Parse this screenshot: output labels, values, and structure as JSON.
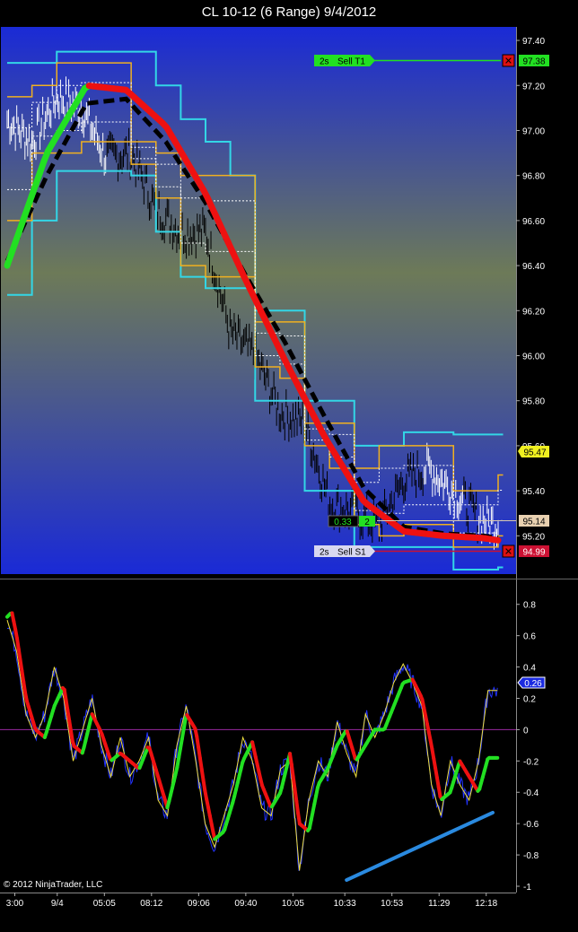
{
  "window": {
    "title": "CL 10-12 (6 Range)  9/4/2012"
  },
  "copyright": "© 2012 NinjaTrader, LLC",
  "colors": {
    "background": "#000000",
    "price_top": "#1a2ad6",
    "price_mid": "#6d7a58",
    "price_bottom": "#1a2ad6",
    "bar_color_up": "#ffffff",
    "bar_color_down": "#000000",
    "bands": "#33d6e6",
    "channel": "#f0b020",
    "inner_band": "#ffffff",
    "osc_fast": "#2233ff",
    "osc_signal": "#f0e040",
    "hma_up": "#22e022",
    "hma_down": "#ee1111",
    "ema_dashed": "#000000",
    "trend_line": "#2a8ae0",
    "zero_line": "#9a2aa0",
    "sell_t1": "#22e022",
    "sell_s1": "#cc1133"
  },
  "chart_data": [
    {
      "type": "line",
      "panel": "price",
      "ylim": [
        95.03,
        97.46
      ],
      "y_ticks": [
        97.4,
        97.2,
        97.0,
        96.8,
        96.6,
        96.4,
        96.2,
        96.0,
        95.8,
        95.6,
        95.4,
        95.2
      ],
      "x_count": 100,
      "series": [
        {
          "role": "price",
          "x": [
            0,
            5,
            10,
            15,
            20,
            25,
            30,
            35,
            40,
            45,
            50,
            55,
            60,
            65,
            70,
            75,
            80,
            85,
            90,
            95,
            99
          ],
          "y": [
            97.05,
            96.95,
            97.15,
            97.1,
            96.88,
            96.9,
            96.65,
            96.55,
            96.55,
            96.1,
            96.0,
            95.75,
            95.7,
            95.35,
            95.3,
            95.25,
            95.45,
            95.5,
            95.4,
            95.28,
            95.25
          ]
        },
        {
          "role": "hma",
          "x": [
            0,
            8,
            16,
            24,
            32,
            40,
            48,
            56,
            64,
            72,
            80,
            88,
            96,
            99
          ],
          "y": [
            96.4,
            96.9,
            97.2,
            97.18,
            97.02,
            96.72,
            96.34,
            95.98,
            95.64,
            95.35,
            95.22,
            95.2,
            95.19,
            95.18
          ]
        },
        {
          "role": "ema_dashed",
          "x": [
            0,
            8,
            16,
            24,
            32,
            40,
            48,
            56,
            64,
            72,
            80,
            88,
            96,
            99
          ],
          "y": [
            96.42,
            96.8,
            97.12,
            97.14,
            96.95,
            96.68,
            96.36,
            96.06,
            95.73,
            95.41,
            95.24,
            95.21,
            95.2,
            95.19
          ]
        },
        {
          "role": "upper_band",
          "x": [
            0,
            5,
            10,
            15,
            20,
            25,
            30,
            35,
            40,
            45,
            50,
            55,
            60,
            65,
            70,
            75,
            80,
            85,
            90,
            95,
            99
          ],
          "y": [
            97.3,
            97.3,
            97.35,
            97.35,
            97.35,
            97.35,
            97.2,
            97.05,
            96.95,
            96.8,
            96.2,
            96.2,
            95.8,
            95.8,
            95.6,
            95.6,
            95.66,
            95.66,
            95.65,
            95.65,
            95.65
          ]
        },
        {
          "role": "lower_band",
          "x": [
            0,
            5,
            10,
            15,
            20,
            25,
            30,
            35,
            40,
            45,
            50,
            55,
            60,
            65,
            70,
            75,
            80,
            85,
            90,
            95,
            99
          ],
          "y": [
            96.27,
            96.6,
            96.82,
            96.82,
            96.82,
            96.8,
            96.55,
            96.35,
            96.3,
            96.3,
            95.8,
            95.8,
            95.4,
            95.4,
            95.15,
            95.15,
            95.15,
            95.15,
            95.05,
            95.05,
            95.06
          ]
        },
        {
          "role": "upper_channel",
          "x": [
            0,
            5,
            10,
            15,
            20,
            25,
            30,
            35,
            40,
            45,
            50,
            55,
            60,
            65,
            70,
            75,
            80,
            85,
            90,
            95,
            99
          ],
          "y": [
            97.15,
            97.2,
            97.3,
            97.3,
            97.3,
            96.95,
            96.9,
            96.8,
            96.8,
            96.8,
            96.15,
            96.15,
            95.7,
            95.7,
            95.5,
            95.6,
            95.6,
            95.6,
            95.4,
            95.4,
            95.47
          ]
        },
        {
          "role": "lower_channel",
          "x": [
            0,
            5,
            10,
            15,
            20,
            25,
            30,
            35,
            40,
            45,
            50,
            55,
            60,
            65,
            70,
            75,
            80,
            85,
            90,
            95,
            99
          ],
          "y": [
            96.6,
            96.9,
            96.9,
            96.95,
            96.95,
            96.85,
            96.7,
            96.4,
            96.35,
            96.35,
            95.95,
            95.9,
            95.6,
            95.5,
            95.25,
            95.2,
            95.25,
            95.25,
            95.15,
            95.15,
            95.2
          ]
        }
      ]
    },
    {
      "type": "line",
      "panel": "oscillator",
      "ylim": [
        -1.0,
        0.85
      ],
      "y_ticks": [
        0.8,
        0.6,
        0.4,
        0.2,
        0,
        -0.2,
        -0.4,
        -0.6,
        -0.8,
        -1
      ],
      "x_labels": [
        "3:00",
        "9/4",
        "05:05",
        "08:12",
        "09:06",
        "09:40",
        "10:05",
        "10:33",
        "10:53",
        "11:29",
        "12:18"
      ],
      "x_label_positions": [
        2,
        11,
        21,
        31,
        41,
        51,
        61,
        72,
        82,
        92,
        102
      ],
      "x_count": 108,
      "series": [
        {
          "role": "smooth",
          "x": [
            0,
            1,
            2,
            4,
            6,
            8,
            10,
            12,
            14,
            16,
            18,
            20,
            22,
            24,
            26,
            28,
            30,
            32,
            34,
            36,
            38,
            40,
            42,
            44,
            46,
            48,
            50,
            52,
            54,
            56,
            58,
            60,
            62,
            64,
            66,
            68,
            70,
            72,
            74,
            76,
            78,
            80,
            82,
            84,
            86,
            88,
            90,
            92,
            94,
            96,
            98,
            100,
            102,
            104
          ],
          "y": [
            0.72,
            0.75,
            0.6,
            0.2,
            0.0,
            -0.05,
            0.15,
            0.28,
            -0.1,
            -0.15,
            0.1,
            -0.02,
            -0.2,
            -0.15,
            -0.2,
            -0.25,
            -0.1,
            -0.3,
            -0.5,
            -0.25,
            0.1,
            0.0,
            -0.4,
            -0.7,
            -0.65,
            -0.45,
            -0.2,
            -0.08,
            -0.35,
            -0.5,
            -0.4,
            -0.15,
            -0.6,
            -0.65,
            -0.35,
            -0.25,
            -0.1,
            0.0,
            -0.2,
            -0.1,
            0.0,
            0.0,
            0.15,
            0.3,
            0.32,
            0.2,
            -0.1,
            -0.45,
            -0.4,
            -0.2,
            -0.3,
            -0.4,
            -0.18,
            -0.18
          ]
        },
        {
          "role": "fast",
          "x": [
            0,
            2,
            4,
            6,
            8,
            10,
            12,
            14,
            16,
            18,
            20,
            22,
            24,
            26,
            28,
            30,
            32,
            34,
            36,
            38,
            40,
            42,
            44,
            46,
            48,
            50,
            52,
            54,
            56,
            58,
            60,
            62,
            64,
            66,
            68,
            70,
            72,
            74,
            76,
            78,
            80,
            82,
            84,
            86,
            88,
            90,
            92,
            94,
            96,
            98,
            100,
            102,
            104
          ],
          "y": [
            0.7,
            0.5,
            0.1,
            -0.05,
            0.1,
            0.4,
            0.2,
            -0.2,
            0.0,
            0.2,
            -0.1,
            -0.3,
            -0.05,
            -0.3,
            -0.2,
            -0.05,
            -0.45,
            -0.55,
            -0.1,
            0.15,
            -0.2,
            -0.6,
            -0.75,
            -0.55,
            -0.35,
            -0.05,
            -0.2,
            -0.5,
            -0.55,
            -0.25,
            -0.2,
            -0.9,
            -0.45,
            -0.2,
            -0.3,
            0.05,
            -0.15,
            -0.3,
            0.1,
            -0.05,
            0.1,
            0.3,
            0.42,
            0.3,
            0.15,
            -0.35,
            -0.55,
            -0.2,
            -0.35,
            -0.45,
            -0.2,
            0.25,
            0.25
          ]
        },
        {
          "role": "trend_line",
          "x": [
            72,
            103
          ],
          "y": [
            -0.96,
            -0.53
          ]
        }
      ]
    }
  ],
  "price_labels": {
    "sell_t1": {
      "qty": "2s",
      "label": "Sell T1",
      "price": "97.38"
    },
    "sell_s1": {
      "qty": "2s",
      "label": "Sell S1",
      "price": "94.99"
    },
    "last_price": "95.47",
    "position_price": "95.14",
    "pnl_value": "0.33",
    "pnl_qty": "2",
    "osc_value": "0.26"
  }
}
